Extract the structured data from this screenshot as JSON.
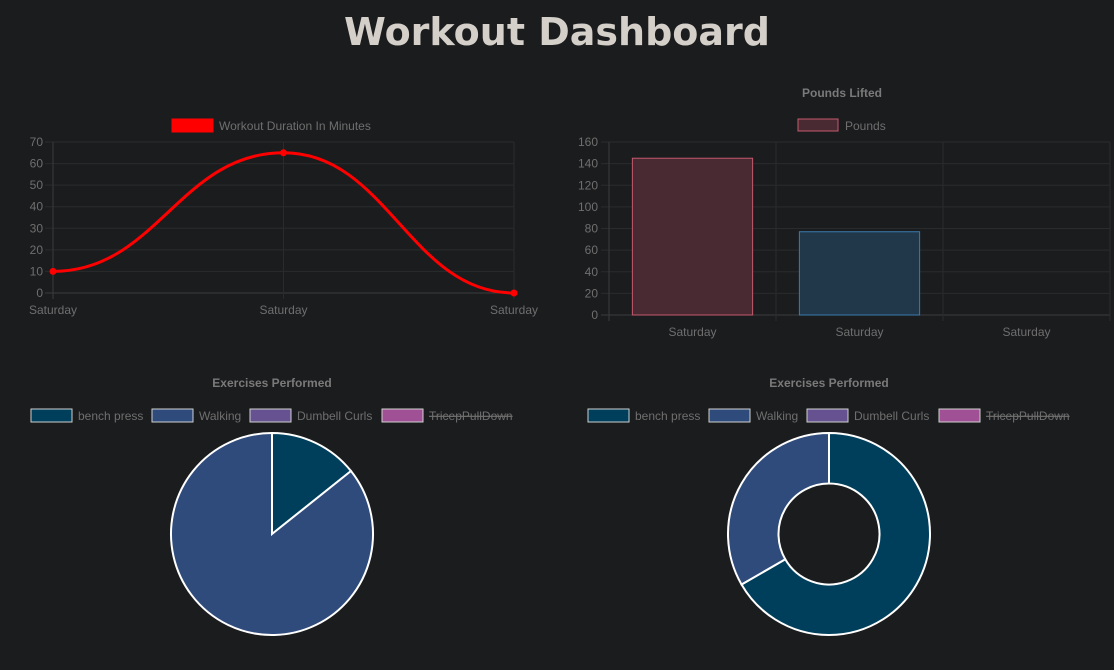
{
  "page": {
    "title": "Workout Dashboard"
  },
  "chart_data": [
    {
      "type": "line",
      "title": "",
      "categories": [
        "Saturday",
        "Saturday",
        "Saturday"
      ],
      "series": [
        {
          "name": "Workout Duration In Minutes",
          "values": [
            10,
            65,
            0
          ],
          "color": "#ff0000"
        }
      ],
      "ylim": [
        0,
        70
      ],
      "yticks": [
        0,
        10,
        20,
        30,
        40,
        50,
        60,
        70
      ],
      "grid": true,
      "legend": "top"
    },
    {
      "type": "bar",
      "title": "Pounds Lifted",
      "categories": [
        "Saturday",
        "Saturday",
        "Saturday"
      ],
      "series": [
        {
          "name": "Pounds",
          "values": [
            145,
            77,
            0
          ],
          "fill_colors": [
            "#4a2a32",
            "#21374a",
            "#21374a"
          ],
          "border_colors": [
            "#c45a6e",
            "#3a7bb0",
            "#3a7bb0"
          ],
          "legend_fill": "#4a2a32",
          "legend_border": "#c45a6e"
        }
      ],
      "ylim": [
        0,
        160
      ],
      "yticks": [
        0,
        20,
        40,
        60,
        80,
        100,
        120,
        140,
        160
      ],
      "grid": true,
      "legend": "top"
    },
    {
      "type": "pie",
      "title": "Exercises Performed",
      "labels": [
        "bench press",
        "Walking",
        "Dumbell Curls",
        "TricepPullDown"
      ],
      "colors": [
        "#003f5c",
        "#2f4b7c",
        "#665191",
        "#a05195"
      ],
      "hidden": [
        false,
        false,
        false,
        true
      ],
      "values": [
        1,
        6,
        0,
        0
      ],
      "legend": "top"
    },
    {
      "type": "doughnut",
      "title": "Exercises Performed",
      "labels": [
        "bench press",
        "Walking",
        "Dumbell Curls",
        "TricepPullDown"
      ],
      "colors": [
        "#003f5c",
        "#2f4b7c",
        "#665191",
        "#a05195"
      ],
      "hidden": [
        false,
        false,
        false,
        true
      ],
      "values": [
        2,
        1,
        0,
        0
      ],
      "legend": "top"
    }
  ]
}
